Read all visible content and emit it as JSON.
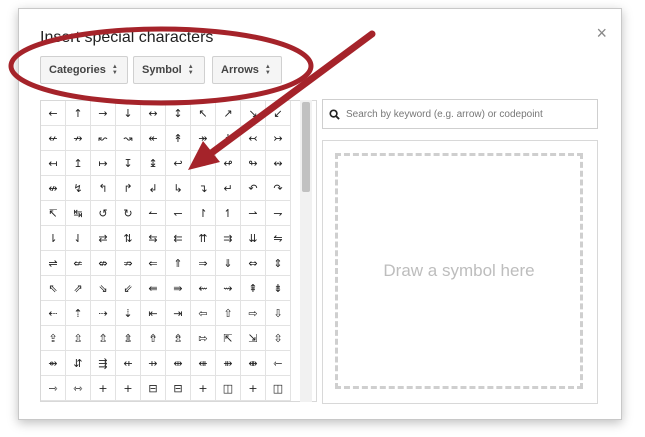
{
  "dialog": {
    "title": "Insert special characters",
    "close_glyph": "×"
  },
  "filters": [
    {
      "label": "Categories"
    },
    {
      "label": "Symbol"
    },
    {
      "label": "Arrows"
    }
  ],
  "search": {
    "placeholder": "Search by keyword (e.g. arrow) or codepoint"
  },
  "draw": {
    "label": "Draw a symbol here"
  },
  "grid": {
    "rows": [
      [
        "←",
        "↑",
        "→",
        "↓",
        "↔",
        "↕",
        "↖",
        "↗",
        "↘",
        "↙"
      ],
      [
        "↚",
        "↛",
        "↜",
        "↝",
        "↞",
        "↟",
        "↠",
        "↡",
        "↢",
        "↣"
      ],
      [
        "↤",
        "↥",
        "↦",
        "↧",
        "↨",
        "↩",
        "↪",
        "↫",
        "↬",
        "↭"
      ],
      [
        "↮",
        "↯",
        "↰",
        "↱",
        "↲",
        "↳",
        "↴",
        "↵",
        "↶",
        "↷"
      ],
      [
        "↸",
        "↹",
        "↺",
        "↻",
        "↼",
        "↽",
        "↾",
        "↿",
        "⇀",
        "⇁"
      ],
      [
        "⇂",
        "⇃",
        "⇄",
        "⇅",
        "⇆",
        "⇇",
        "⇈",
        "⇉",
        "⇊",
        "⇋"
      ],
      [
        "⇌",
        "⇍",
        "⇎",
        "⇏",
        "⇐",
        "⇑",
        "⇒",
        "⇓",
        "⇔",
        "⇕"
      ],
      [
        "⇖",
        "⇗",
        "⇘",
        "⇙",
        "⇚",
        "⇛",
        "⇜",
        "⇝",
        "⇞",
        "⇟"
      ],
      [
        "⇠",
        "⇡",
        "⇢",
        "⇣",
        "⇤",
        "⇥",
        "⇦",
        "⇧",
        "⇨",
        "⇩"
      ],
      [
        "⇪",
        "⇫",
        "⇬",
        "⇭",
        "⇮",
        "⇯",
        "⇰",
        "⇱",
        "⇲",
        "⇳"
      ],
      [
        "⇴",
        "⇵",
        "⇶",
        "⇷",
        "⇸",
        "⇹",
        "⇺",
        "⇻",
        "⇼",
        "⇽"
      ],
      [
        "⇾",
        "⇿",
        "+",
        "+",
        "⊟",
        "⊟",
        "+",
        "◫",
        "+",
        "◫"
      ]
    ]
  },
  "colors": {
    "annotation": "#a5232a"
  }
}
